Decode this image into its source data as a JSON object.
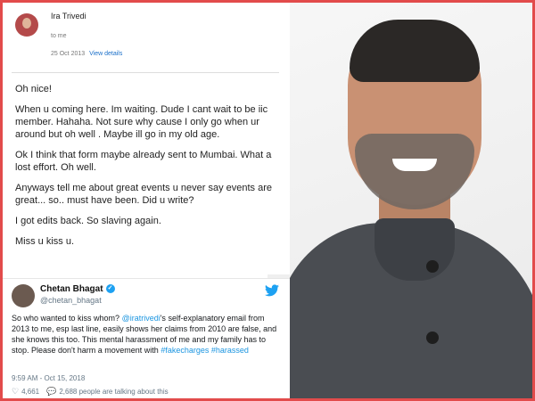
{
  "email": {
    "sender": "Ira Trivedi",
    "to": "to me",
    "date": "25 Oct 2013",
    "view_details": "View details",
    "paragraphs": [
      "Oh nice!",
      "When u coming here.  Im waiting. Dude I cant wait to be iic member. Hahaha. Not sure why cause I only go when ur around but oh well . Maybe ill go in my old age.",
      "Ok I think that form maybe already sent to Mumbai. What a lost effort.  Oh well.",
      "Anyways tell me about great events u never say events are great... so.. must have been. Did u write?",
      "I got edits back.  So slaving again.",
      "Miss u kiss u."
    ]
  },
  "tweet": {
    "name": "Chetan Bhagat",
    "handle": "@chetan_bhagat",
    "text_1": "So who wanted to kiss whom? ",
    "mention": "@iratrivedi",
    "text_2": "'s self-explanatory email from 2013 to me, esp last line, easily shows her claims from 2010 are false, and she knows this too. This mental harassment of me and my family has to stop. Please don't harm a movement with ",
    "hashtag_1": "#fakecharges",
    "hashtag_2": "#harassed",
    "timestamp": "9:59 AM - Oct 15, 2018",
    "likes": "4,661",
    "talking": "2,688 people are talking about this"
  },
  "icons": {
    "like": "heart-icon",
    "reply": "speech-bubble-icon",
    "brand": "twitter-bird-icon",
    "verified": "verified-badge-icon"
  },
  "colors": {
    "frame": "#e24b4b",
    "link": "#1a6fc9",
    "twitter_blue": "#1da1f2",
    "hashtag": "#1b95e0"
  }
}
